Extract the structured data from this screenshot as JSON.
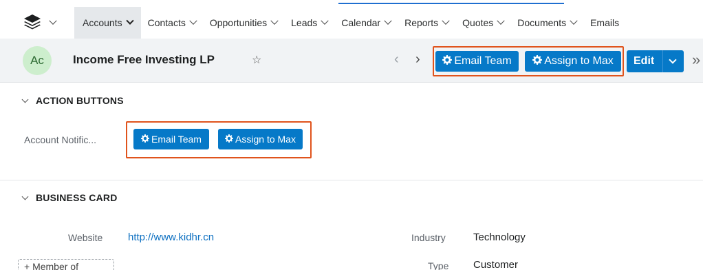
{
  "nav": {
    "items": [
      {
        "label": "Accounts",
        "active": true
      },
      {
        "label": "Contacts"
      },
      {
        "label": "Opportunities"
      },
      {
        "label": "Leads"
      },
      {
        "label": "Calendar"
      },
      {
        "label": "Reports"
      },
      {
        "label": "Quotes"
      },
      {
        "label": "Documents"
      },
      {
        "label": "Emails"
      }
    ]
  },
  "record": {
    "avatar_initials": "Ac",
    "title": "Income Free Investing LP",
    "star_glyph": "☆",
    "prev_glyph": "‹",
    "next_glyph": "›",
    "header_buttons": [
      {
        "label": "Email Team",
        "icon": "gear-icon"
      },
      {
        "label": "Assign to Max",
        "icon": "gear-icon"
      }
    ],
    "edit_label": "Edit",
    "more_glyph": "»"
  },
  "sections": {
    "action_buttons": {
      "title": "ACTION BUTTONS",
      "field_label": "Account Notific...",
      "buttons": [
        {
          "label": "Email Team",
          "icon": "gear-icon"
        },
        {
          "label": "Assign to Max",
          "icon": "gear-icon"
        }
      ]
    },
    "business_card": {
      "title": "BUSINESS CARD",
      "website_label": "Website",
      "website_value": "http://www.kidhr.cn",
      "industry_label": "Industry",
      "industry_value": "Technology",
      "type_label": "Type",
      "type_value": "Customer",
      "member_of_label": "+ Member of"
    }
  },
  "colors": {
    "accent": "#0679c8",
    "highlight": "#e0531c",
    "avatar_bg": "#cdeecd"
  }
}
